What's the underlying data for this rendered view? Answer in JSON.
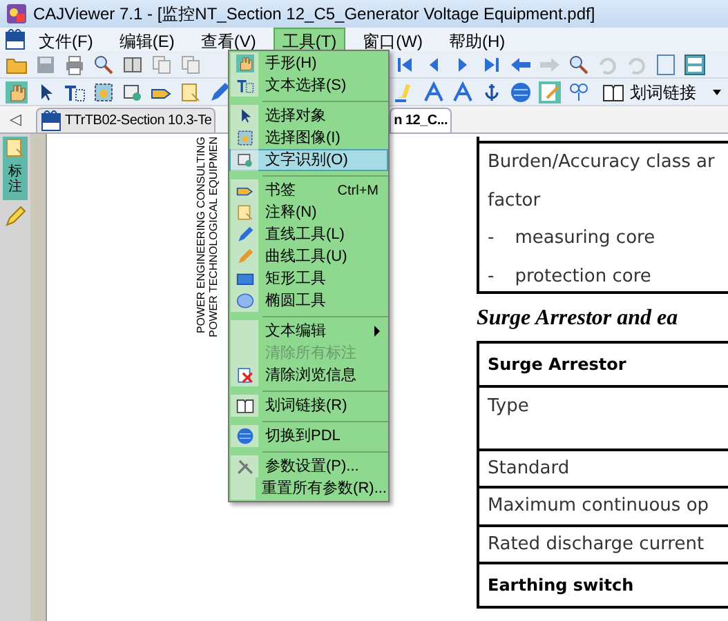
{
  "window": {
    "title": "CAJViewer 7.1 - [监控NT_Section 12_C5_Generator Voltage Equipment.pdf]"
  },
  "menu_bar": [
    {
      "label": "文件(F)",
      "selected": false
    },
    {
      "label": "编辑(E)",
      "selected": false
    },
    {
      "label": "查看(V)",
      "selected": false
    },
    {
      "label": "工具(T)",
      "selected": true
    },
    {
      "label": "窗口(W)",
      "selected": false
    },
    {
      "label": "帮助(H)",
      "selected": false
    }
  ],
  "toolbar": {
    "word_link_button": "划词链接"
  },
  "tabs": [
    {
      "label": "TTrTB02-Section 10.3-Te",
      "selected": false
    },
    {
      "label": "n 12_C...",
      "selected": true
    }
  ],
  "tab_scroll": "◁",
  "side_panel": {
    "tabs": [
      {
        "label": "标注",
        "selected": true
      }
    ]
  },
  "document": {
    "side_text": [
      "POWER ENGINEERING CONSULTING",
      "POWER TECHNOLOGICAL EQUIPMEN"
    ],
    "table_1": [
      {
        "lines": [
          {
            "text": "Burden/Accuracy class ar"
          },
          {
            "text": "factor"
          },
          {
            "marker": "-",
            "text": "measuring core"
          },
          {
            "marker": "-",
            "text": "protection core"
          }
        ]
      }
    ],
    "heading": "Surge Arrestor and ea",
    "table_2": [
      {
        "kind": "header",
        "text": "Surge Arrestor"
      },
      {
        "kind": "tall",
        "text": "Type"
      },
      {
        "kind": "row",
        "text": "Standard"
      },
      {
        "kind": "row",
        "text": "Maximum continuous op"
      },
      {
        "kind": "row",
        "text": "Rated discharge current"
      },
      {
        "kind": "header",
        "text": "Earthing switch"
      }
    ]
  },
  "tools_menu": [
    {
      "kind": "item",
      "label": "手形(H)",
      "selected": false,
      "disabled": false,
      "has_submenu": false
    },
    {
      "kind": "item",
      "label": "文本选择(S)",
      "selected": false,
      "disabled": false,
      "has_submenu": false
    },
    {
      "kind": "separator"
    },
    {
      "kind": "item",
      "label": "选择对象",
      "selected": false,
      "disabled": false,
      "has_submenu": false
    },
    {
      "kind": "item",
      "label": "选择图像(I)",
      "selected": false,
      "disabled": false,
      "has_submenu": false
    },
    {
      "kind": "item",
      "label": "文字识别(O)",
      "selected": true,
      "disabled": false,
      "has_submenu": false
    },
    {
      "kind": "separator"
    },
    {
      "kind": "item",
      "label": "书签",
      "shortcut": "Ctrl+M",
      "selected": false,
      "disabled": false,
      "has_submenu": false
    },
    {
      "kind": "item",
      "label": "注释(N)",
      "selected": false,
      "disabled": false,
      "has_submenu": false
    },
    {
      "kind": "item",
      "label": "直线工具(L)",
      "selected": false,
      "disabled": false,
      "has_submenu": false
    },
    {
      "kind": "item",
      "label": "曲线工具(U)",
      "selected": false,
      "disabled": false,
      "has_submenu": false
    },
    {
      "kind": "item",
      "label": "矩形工具",
      "selected": false,
      "disabled": false,
      "has_submenu": false
    },
    {
      "kind": "item",
      "label": "椭圆工具",
      "selected": false,
      "disabled": false,
      "has_submenu": false
    },
    {
      "kind": "separator"
    },
    {
      "kind": "item",
      "label": "文本编辑",
      "selected": false,
      "disabled": false,
      "has_submenu": true
    },
    {
      "kind": "item",
      "label": "清除所有标注",
      "selected": false,
      "disabled": true,
      "has_submenu": false
    },
    {
      "kind": "item",
      "label": "清除浏览信息",
      "selected": false,
      "disabled": false,
      "has_submenu": false
    },
    {
      "kind": "separator"
    },
    {
      "kind": "item",
      "label": "划词链接(R)",
      "selected": false,
      "disabled": false,
      "has_submenu": false
    },
    {
      "kind": "separator"
    },
    {
      "kind": "item",
      "label": "切换到PDL",
      "selected": false,
      "disabled": false,
      "has_submenu": false
    },
    {
      "kind": "separator"
    },
    {
      "kind": "item",
      "label": "参数设置(P)...",
      "selected": false,
      "disabled": false,
      "has_submenu": false
    },
    {
      "kind": "item",
      "label": "重置所有参数(R)...",
      "selected": false,
      "disabled": false,
      "has_submenu": false
    }
  ]
}
